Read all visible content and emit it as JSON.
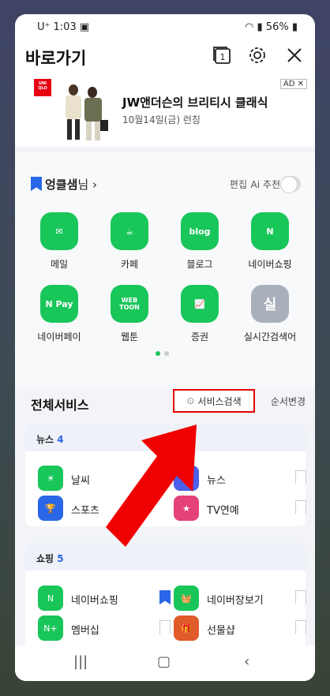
{
  "status_bar": {
    "carrier": "U⁺",
    "time": "1:03",
    "battery": "56%"
  },
  "header": {
    "title": "바로가기",
    "tab_count": "1"
  },
  "ad": {
    "brand": "UNI QLO",
    "headline": "JW앤더슨의 브리티시 클래식",
    "subline": "10월14일(금) 런칭",
    "badge": "AD ✕"
  },
  "favorites": {
    "user": "엉클샘",
    "suffix": "님",
    "edit_label": "편집",
    "ai_label": "Ai 추천",
    "apps": [
      {
        "label": "메일",
        "color": "#19c65a"
      },
      {
        "label": "카페",
        "color": "#19c65a"
      },
      {
        "label": "블로그",
        "color": "#19c65a"
      },
      {
        "label": "네이버쇼핑",
        "color": "#19c65a"
      },
      {
        "label": "네이버페이",
        "color": "#19c65a"
      },
      {
        "label": "웹툰",
        "color": "#19c65a"
      },
      {
        "label": "증권",
        "color": "#19c65a"
      },
      {
        "label": "실시간검색어",
        "color": "#a9b0bc"
      }
    ]
  },
  "services": {
    "title": "전체서비스",
    "search_label": "서비스검색",
    "order_label": "순서변경",
    "news": {
      "title": "뉴스",
      "count": "4",
      "items": [
        {
          "label": "날씨",
          "color": "#19c65a"
        },
        {
          "label": "뉴스",
          "color": "#4d5ee8"
        },
        {
          "label": "스포츠",
          "color": "#2a67e8"
        },
        {
          "label": "TV연예",
          "color": "#e6427a"
        }
      ]
    },
    "shopping": {
      "title": "쇼핑",
      "count": "5",
      "items": [
        {
          "label": "네이버쇼핑",
          "color": "#19c65a"
        },
        {
          "label": "네이버장보기",
          "color": "#19c65a"
        },
        {
          "label": "멤버십",
          "color": "#19c65a"
        },
        {
          "label": "선물샵",
          "color": "#e05a2a"
        }
      ]
    }
  },
  "icons": [
    "settings-icon",
    "close-icon",
    "tabs-icon",
    "search-icon",
    "back-icon",
    "home-icon",
    "recents-icon"
  ]
}
